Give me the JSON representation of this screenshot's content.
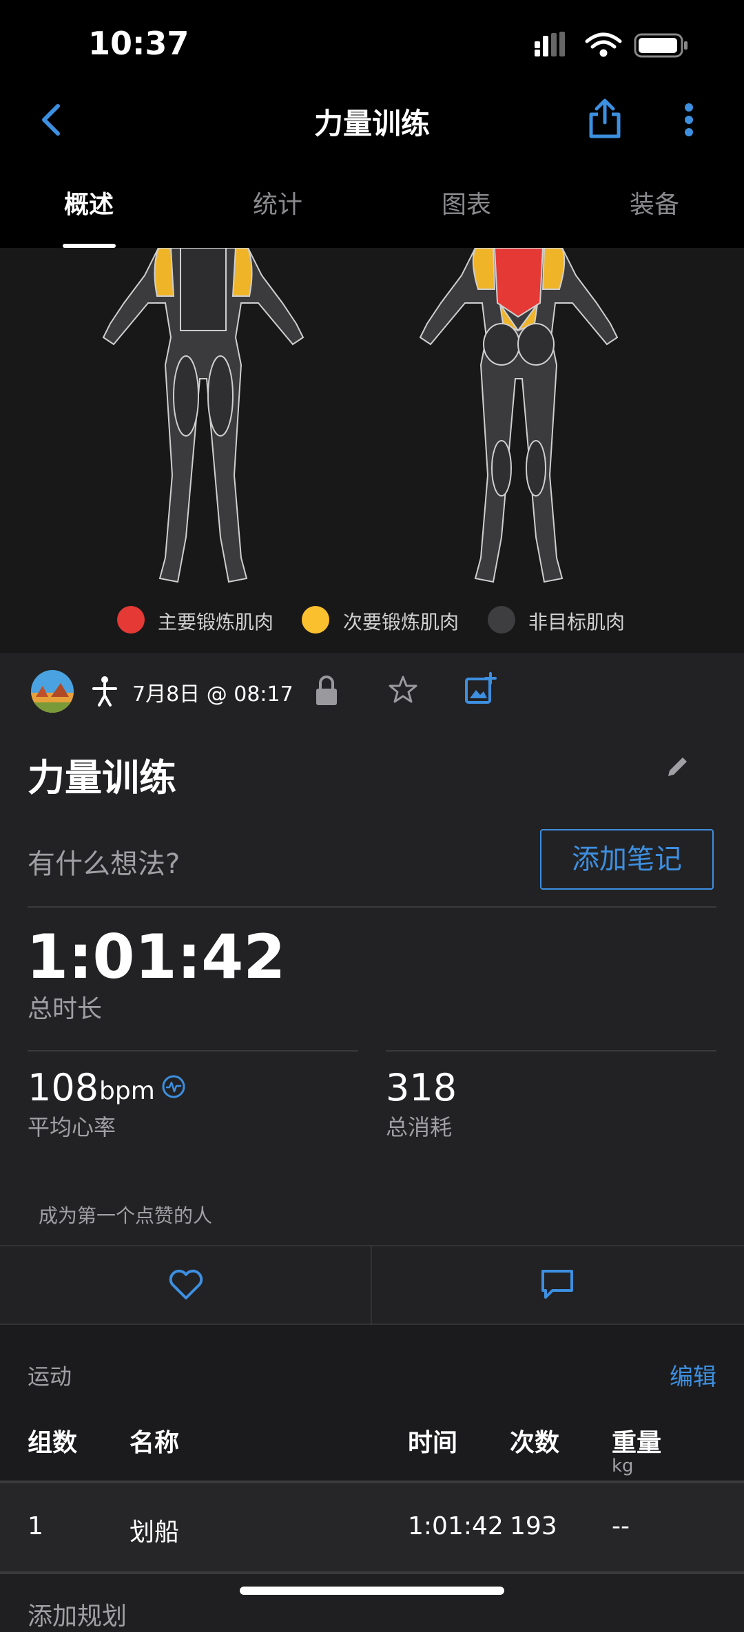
{
  "status_bar": {
    "time": "10:37"
  },
  "header": {
    "title": "力量训练",
    "back_icon": "chevron-left-icon",
    "share_icon": "share-icon",
    "more_icon": "more-vertical-icon"
  },
  "tabs": [
    {
      "label": "概述",
      "active": true
    },
    {
      "label": "统计",
      "active": false
    },
    {
      "label": "图表",
      "active": false
    },
    {
      "label": "装备",
      "active": false
    }
  ],
  "legend": [
    {
      "label": "主要锻炼肌肉",
      "color": "#e53935"
    },
    {
      "label": "次要锻炼肌肉",
      "color": "#fbc02d"
    },
    {
      "label": "非目标肌肉",
      "color": "#3e3e40"
    }
  ],
  "activity": {
    "date": "7月8日 @ 08:17",
    "name": "力量训练",
    "note_placeholder": "有什么想法?",
    "add_note_label": "添加笔记",
    "duration": "1:01:42",
    "duration_label": "总时长",
    "avg_hr_value": "108",
    "avg_hr_unit": "bpm",
    "avg_hr_label": "平均心率",
    "calories_value": "318",
    "calories_label": "总消耗",
    "likes_text": "成为第一个点赞的人"
  },
  "exercises": {
    "section_label": "运动",
    "edit_label": "编辑",
    "columns": {
      "set": "组数",
      "name": "名称",
      "time": "时间",
      "reps": "次数",
      "weight": "重量",
      "weight_unit": "kg"
    },
    "rows": [
      {
        "set": "1",
        "name": "划船",
        "time": "1:01:42",
        "reps": "193",
        "weight": "--"
      }
    ],
    "next_label": "添加规划"
  },
  "colors": {
    "accent": "#3d8fe0",
    "primary_muscle": "#e53935",
    "secondary_muscle": "#fbc02d"
  }
}
